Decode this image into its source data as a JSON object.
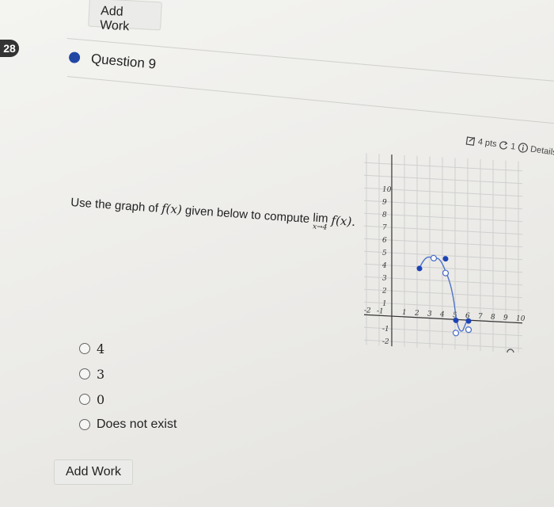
{
  "top_button": {
    "label": "Add Work"
  },
  "bottom_button": {
    "label": "Add Work"
  },
  "question": {
    "number_badge": "28",
    "title": "Question 9"
  },
  "meta": {
    "points": "4 pts",
    "retries": "1",
    "details": "Details"
  },
  "prompt": {
    "text_before": "Use the graph of ",
    "func": "f(x)",
    "text_middle": " given below to compute ",
    "lim_word": "lim",
    "lim_sub": "x→4",
    "lim_func": "f(x)."
  },
  "options": [
    {
      "label": "4",
      "math": true
    },
    {
      "label": "3",
      "math": true
    },
    {
      "label": "0",
      "math": true
    },
    {
      "label": "Does not exist",
      "math": false
    }
  ],
  "graph": {
    "x_ticks": [
      "-2",
      "-1",
      "1",
      "2",
      "3",
      "4",
      "5",
      "6",
      "7",
      "8",
      "9",
      "10"
    ],
    "y_ticks": [
      "10",
      "9",
      "8",
      "7",
      "6",
      "5",
      "4",
      "3",
      "2",
      "1",
      "-1",
      "-2"
    ],
    "magnifier": "magnifier-icon"
  }
}
